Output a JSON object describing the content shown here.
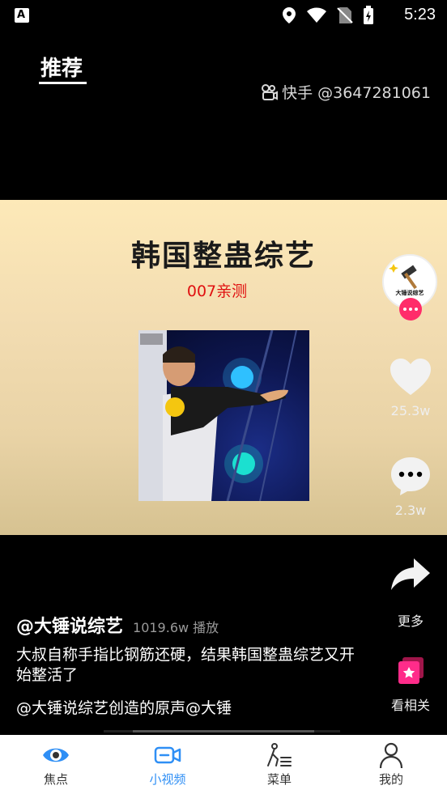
{
  "status_bar": {
    "time": "5:23",
    "left_icon_letter": "A"
  },
  "top_tab": {
    "label": "推荐"
  },
  "watermark": {
    "text": "快手 @3647281061"
  },
  "video": {
    "title": "韩国整蛊综艺",
    "subtitle": "007亲测"
  },
  "creator": {
    "avatar_text": "大锤说综艺"
  },
  "actions": {
    "like_count": "25.3w",
    "comment_count": "2.3w",
    "more_label": "更多",
    "related_label": "看相关"
  },
  "post": {
    "author": "@大锤说综艺",
    "plays": "1019.6w 播放",
    "description": "大叔自称手指比钢筋还硬，结果韩国整蛊综艺又开始整活了",
    "music": "@大锤说综艺创造的原声@大锤"
  },
  "bottom_nav": [
    {
      "label": "焦点",
      "icon": "eye-icon"
    },
    {
      "label": "小视频",
      "icon": "video-camera-icon"
    },
    {
      "label": "菜单",
      "icon": "menu-list-icon"
    },
    {
      "label": "我的",
      "icon": "user-icon"
    }
  ],
  "active_tab": "小视频",
  "colors": {
    "accent_blue": "#2f8ff5",
    "pink": "#ff2c6a",
    "subtitle_red": "#e01010"
  }
}
